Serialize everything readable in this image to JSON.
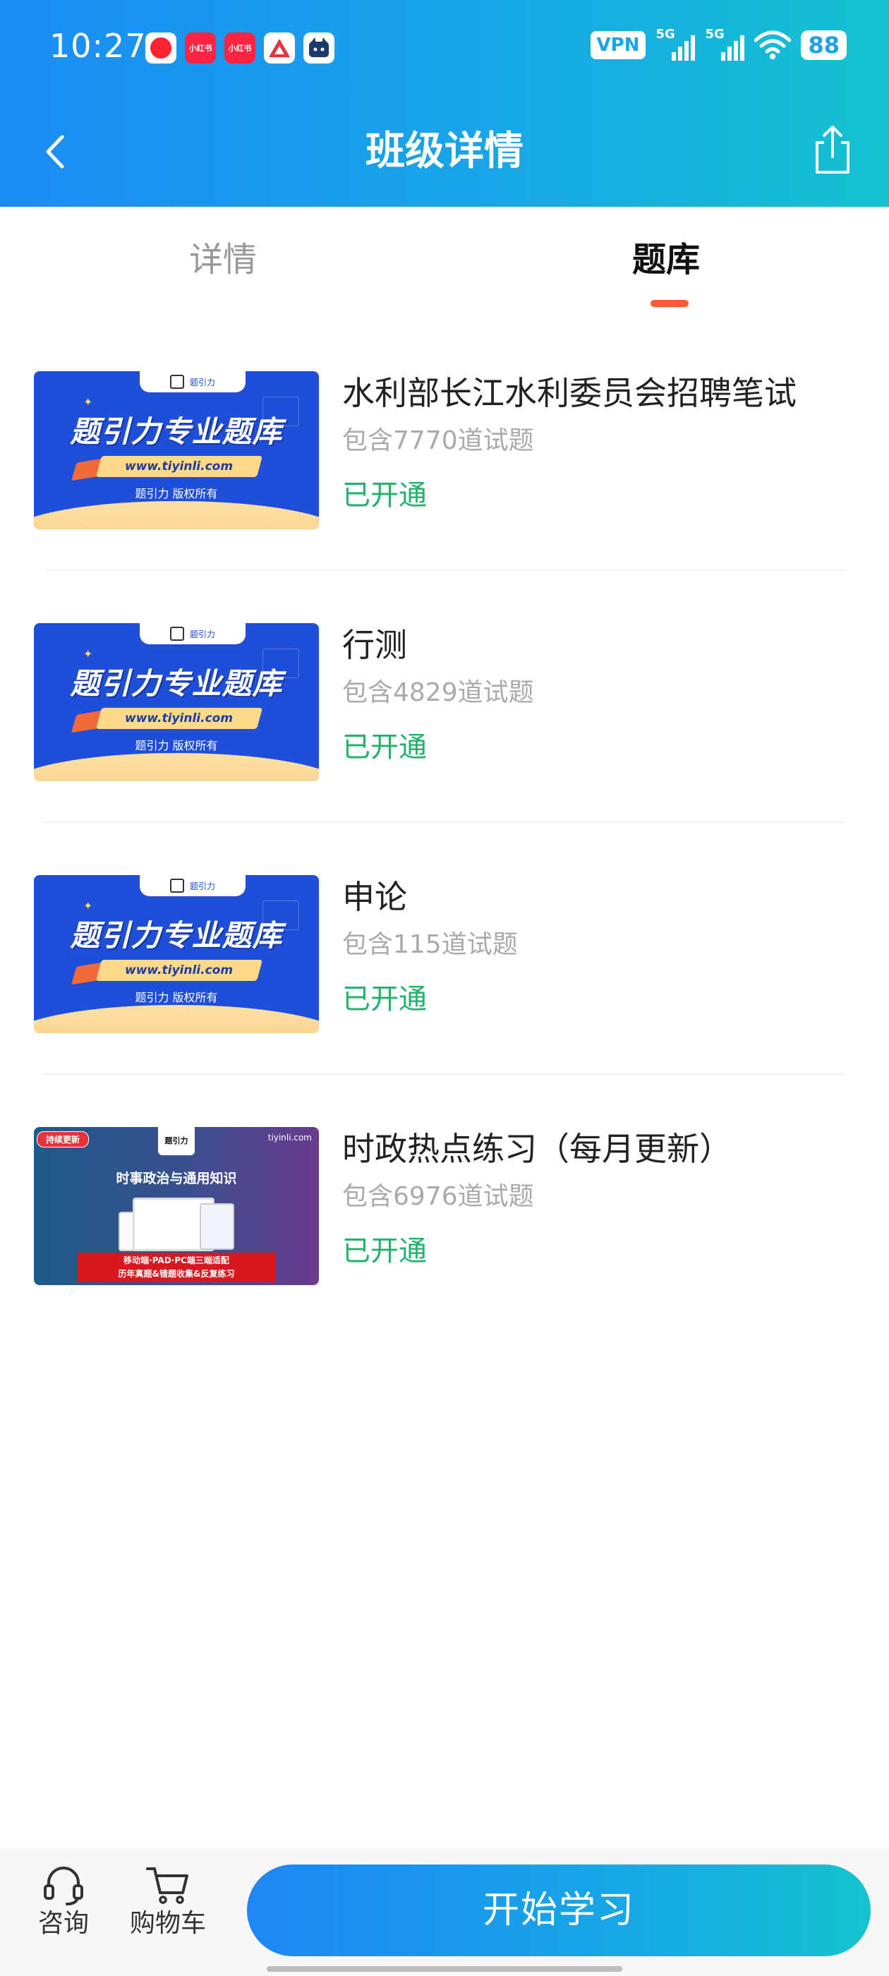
{
  "status_bar": {
    "time": "10:27",
    "vpn": "VPN",
    "signal1": "5G",
    "signal2": "5G",
    "battery": "88"
  },
  "header": {
    "title": "班级详情"
  },
  "tabs": [
    {
      "label": "详情",
      "active": false
    },
    {
      "label": "题库",
      "active": true
    }
  ],
  "thumbs": {
    "a_top": "题引力",
    "a_headline": "题引力专业题库",
    "a_url": "www.tiyinli.com",
    "a_copy": "题引力 版权所有",
    "b_badge": "持续更新",
    "b_brand": "题引力",
    "b_domain": "tiyinli.com",
    "b_headline": "时事政治与通用知识",
    "b_banner1": "移动端·PAD·PC端三端适配",
    "b_banner2": "历年真题&错题收集&反复练习"
  },
  "items": [
    {
      "title": "水利部长江水利委员会招聘笔试",
      "count": "包含7770道试题",
      "status": "已开通"
    },
    {
      "title": "行测",
      "count": "包含4829道试题",
      "status": "已开通"
    },
    {
      "title": "申论",
      "count": "包含115道试题",
      "status": "已开通"
    },
    {
      "title": "时政热点练习（每月更新）",
      "count": "包含6976道试题",
      "status": "已开通"
    }
  ],
  "bottom_bar": {
    "consult_label": "咨询",
    "cart_label": "购物车",
    "start_label": "开始学习"
  },
  "colors": {
    "accent_blue": "#1a8cf5",
    "accent_teal": "#14c2cf",
    "status_green": "#21b36b",
    "tab_indicator": "#ff5a30"
  }
}
